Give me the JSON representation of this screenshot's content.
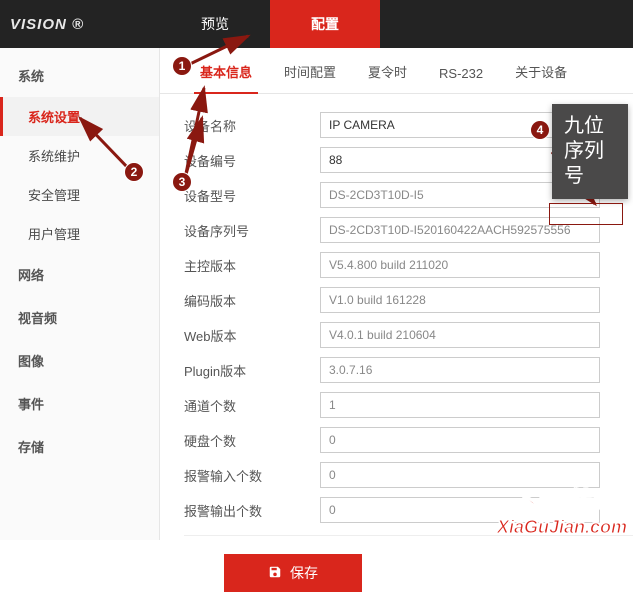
{
  "brand": "VISION ®",
  "topnav": {
    "preview": "预览",
    "config": "配置"
  },
  "sidebar": {
    "group_system": "系统",
    "items": [
      {
        "label": "系统设置"
      },
      {
        "label": "系统维护"
      },
      {
        "label": "安全管理"
      },
      {
        "label": "用户管理"
      }
    ],
    "group_network": "网络",
    "group_av": "视音频",
    "group_image": "图像",
    "group_event": "事件",
    "group_storage": "存储"
  },
  "tabs": {
    "basic": "基本信息",
    "time": "时间配置",
    "dst": "夏令时",
    "rs232": "RS-232",
    "about": "关于设备"
  },
  "form": {
    "rows": [
      {
        "label": "设备名称",
        "value": "IP CAMERA",
        "editable": true
      },
      {
        "label": "设备编号",
        "value": "88",
        "editable": true
      },
      {
        "label": "设备型号",
        "value": "DS-2CD3T10D-I5",
        "editable": false
      },
      {
        "label": "设备序列号",
        "value": "DS-2CD3T10D-I520160422AACH592575556",
        "editable": false
      },
      {
        "label": "主控版本",
        "value": "V5.4.800 build 211020",
        "editable": false
      },
      {
        "label": "编码版本",
        "value": "V1.0 build 161228",
        "editable": false
      },
      {
        "label": "Web版本",
        "value": "V4.0.1 build 210604",
        "editable": false
      },
      {
        "label": "Plugin版本",
        "value": "3.0.7.16",
        "editable": false
      },
      {
        "label": "通道个数",
        "value": "1",
        "editable": false
      },
      {
        "label": "硬盘个数",
        "value": "0",
        "editable": false
      },
      {
        "label": "报警输入个数",
        "value": "0",
        "editable": false
      },
      {
        "label": "报警输出个数",
        "value": "0",
        "editable": false
      }
    ],
    "save_label": "保存"
  },
  "annotations": {
    "b1": "1",
    "b2": "2",
    "b3": "3",
    "b4": "4",
    "callout": "九位序列号"
  },
  "watermark": {
    "cn": "下固件网",
    "en": "XiaGuJian.com"
  }
}
